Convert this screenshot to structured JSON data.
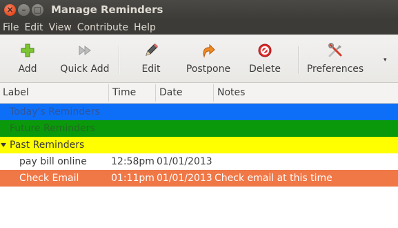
{
  "window": {
    "title": "Manage Reminders",
    "close_glyph": "×",
    "min_glyph": "–",
    "max_glyph": "□"
  },
  "menu": [
    "File",
    "Edit",
    "View",
    "Contribute",
    "Help"
  ],
  "toolbar": {
    "add": "Add",
    "quick_add": "Quick Add",
    "edit": "Edit",
    "postpone": "Postpone",
    "delete": "Delete",
    "preferences": "Preferences",
    "overflow_glyph": "▾"
  },
  "columns": {
    "label": "Label",
    "time": "Time",
    "date": "Date",
    "notes": "Notes"
  },
  "categories": {
    "today": "Today's Reminders",
    "future": "Future Reminders",
    "past": "Past Reminders"
  },
  "reminders": [
    {
      "label": "pay bill online",
      "time": "12:58pm",
      "date": "01/01/2013",
      "notes": ""
    },
    {
      "label": "Check Email",
      "time": "01:11pm",
      "date": "01/01/2013",
      "notes": "Check email at this time"
    }
  ],
  "colors": {
    "today_bg": "#0d6ff8",
    "future_bg": "#0a990a",
    "past_bg": "#ffff00",
    "selected_row_bg": "#f07746"
  }
}
